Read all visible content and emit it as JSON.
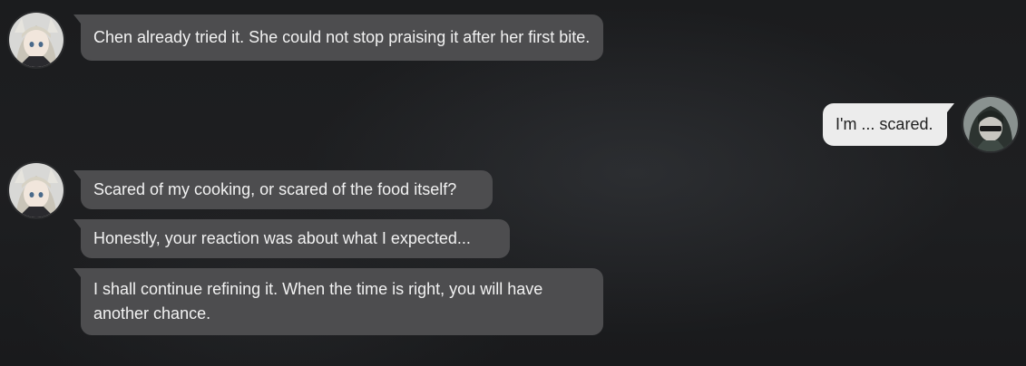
{
  "messages": [
    {
      "speaker": "npc",
      "avatar": "blonde-girl-avatar",
      "text": "Chen already tried it. She could not stop praising it after her first bite."
    },
    {
      "speaker": "player",
      "avatar": "dark-haired-masked-avatar",
      "text": "I'm ... scared."
    },
    {
      "speaker": "npc",
      "avatar": "blonde-girl-avatar",
      "text": "Scared of my cooking, or scared of the food itself?"
    },
    {
      "speaker": "npc",
      "avatar": "",
      "text": "Honestly, your reaction was about what I expected..."
    },
    {
      "speaker": "npc",
      "avatar": "",
      "text": "I shall continue refining it. When the time is right, you will have another chance."
    }
  ],
  "colors": {
    "background": "#1c1d1f",
    "npc_bubble": "#4d4d4f",
    "npc_text": "#f2f2f2",
    "player_bubble": "#ececec",
    "player_text": "#222222"
  }
}
